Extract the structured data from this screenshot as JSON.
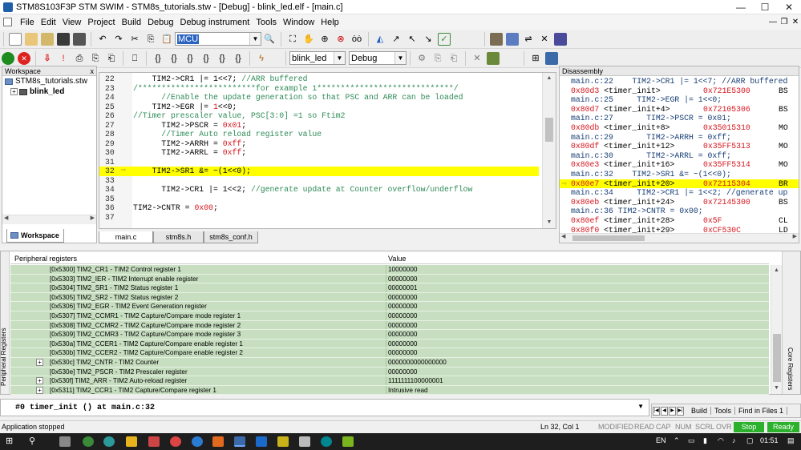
{
  "window": {
    "title": "STM8S103F3P STM SWIM - STM8s_tutorials.stw - [Debug] - blink_led.elf - [main.c]",
    "controls": {
      "minimize": "—",
      "maximize": "☐",
      "close": "✕"
    }
  },
  "menu": {
    "items": [
      "File",
      "Edit",
      "View",
      "Project",
      "Build",
      "Debug",
      "Debug instrument",
      "Tools",
      "Window",
      "Help"
    ]
  },
  "toolbar1": {
    "search_value": "MCU"
  },
  "toolbar2": {
    "project_combo": "blink_led",
    "config_combo": "Debug"
  },
  "workspace": {
    "header": "Workspace",
    "close": "x",
    "root": "STM8s_tutorials.stw",
    "project": "blink_led",
    "tab": "Workspace"
  },
  "editor": {
    "tabs": [
      "main.c",
      "stm8s.h",
      "stm8s_conf.h"
    ],
    "lines": [
      {
        "n": "22",
        "parts": [
          {
            "t": "    TIM2->CR1 |= 1<<7; "
          },
          {
            "t": "//ARR buffered",
            "c": "cm"
          }
        ]
      },
      {
        "n": "23",
        "parts": [
          {
            "t": "/*************************for example 1*****************************/",
            "c": "cm"
          }
        ]
      },
      {
        "n": "24",
        "parts": [
          {
            "t": "      //Enable the update generation so that PSC and ARR can be loaded",
            "c": "cm"
          }
        ]
      },
      {
        "n": "25",
        "parts": [
          {
            "t": "    TIM2->EGR |= "
          },
          {
            "t": "1",
            "c": "num"
          },
          {
            "t": "<<0;"
          }
        ]
      },
      {
        "n": "26",
        "parts": [
          {
            "t": "//Timer prescaler value, PSC[3:0] =1 so Ftim2",
            "c": "cm"
          }
        ]
      },
      {
        "n": "27",
        "parts": [
          {
            "t": "      TIM2->PSCR = "
          },
          {
            "t": "0x01",
            "c": "num"
          },
          {
            "t": ";"
          }
        ]
      },
      {
        "n": "28",
        "parts": [
          {
            "t": "      //Timer Auto reload register value",
            "c": "cm"
          }
        ]
      },
      {
        "n": "29",
        "parts": [
          {
            "t": "      TIM2->ARRH = "
          },
          {
            "t": "0xff",
            "c": "num"
          },
          {
            "t": ";"
          }
        ]
      },
      {
        "n": "30",
        "parts": [
          {
            "t": "      TIM2->ARRL = "
          },
          {
            "t": "0xff",
            "c": "num"
          },
          {
            "t": ";"
          }
        ]
      },
      {
        "n": "31",
        "parts": []
      },
      {
        "n": "32",
        "parts": [
          {
            "t": "    TIM2->SR1 &= ~(1<<0);"
          }
        ],
        "current": true
      },
      {
        "n": "33",
        "parts": []
      },
      {
        "n": "34",
        "parts": [
          {
            "t": "      TIM2->CR1 |= 1<<2; "
          },
          {
            "t": "//generate update at Counter overflow/underflow",
            "c": "cm"
          }
        ]
      },
      {
        "n": "35",
        "parts": []
      },
      {
        "n": "36",
        "parts": [
          {
            "t": "TIM2->CNTR = "
          },
          {
            "t": "0x00",
            "c": "num"
          },
          {
            "t": ";"
          }
        ]
      },
      {
        "n": "37",
        "parts": []
      }
    ]
  },
  "disassembly": {
    "header": "Disassembly",
    "lines": [
      {
        "kind": "src",
        "text": "main.c:22    TIM2->CR1 |= 1<<7; //ARR buffered"
      },
      {
        "kind": "asm",
        "addr": "0x80d3",
        "sym": " <timer_init>",
        "code": "0x721E5300",
        "mn": "BS"
      },
      {
        "kind": "src",
        "text": "main.c:25     TIM2->EGR |= 1<<0;"
      },
      {
        "kind": "asm",
        "addr": "0x80d7",
        "sym": " <timer_init+4>",
        "code": "0x72105306",
        "mn": "BS"
      },
      {
        "kind": "src",
        "text": "main.c:27       TIM2->PSCR = 0x01;"
      },
      {
        "kind": "asm",
        "addr": "0x80db",
        "sym": " <timer_init+8>",
        "code": "0x35015310",
        "mn": "MO"
      },
      {
        "kind": "src",
        "text": "main.c:29       TIM2->ARRH = 0xff;"
      },
      {
        "kind": "asm",
        "addr": "0x80df",
        "sym": " <timer_init+12>",
        "code": "0x35FF5313",
        "mn": "MO"
      },
      {
        "kind": "src",
        "text": "main.c:30       TIM2->ARRL = 0xff;"
      },
      {
        "kind": "asm",
        "addr": "0x80e3",
        "sym": " <timer_init+16>",
        "code": "0x35FF5314",
        "mn": "MO"
      },
      {
        "kind": "src",
        "text": "main.c:32    TIM2->SR1 &= ~(1<<0);"
      },
      {
        "kind": "asm",
        "addr": "0x80e7",
        "sym": " <timer_init+20>",
        "code": "0x72115304",
        "mn": "BR",
        "current": true
      },
      {
        "kind": "src",
        "text": "main.c:34     TIM2->CR1 |= 1<<2; //generate up"
      },
      {
        "kind": "asm",
        "addr": "0x80eb",
        "sym": " <timer_init+24>",
        "code": "0x72145300",
        "mn": "BS"
      },
      {
        "kind": "src",
        "text": "main.c:36 TIM2->CNTR = 0x00;"
      },
      {
        "kind": "asm",
        "addr": "0x80ef",
        "sym": " <timer_init+28>",
        "code": "0x5F",
        "mn": "CL"
      },
      {
        "kind": "asm",
        "addr": "0x80f0",
        "sym": " <timer_init+29>",
        "code": "0xCF530C",
        "mn": "LD"
      }
    ]
  },
  "peripheral": {
    "col_name": "Peripheral registers",
    "col_value": "Value",
    "side_label": "Peripheral Registers",
    "core_label": "Core Registers",
    "rows": [
      {
        "name": "[0x5300] TIM2_CR1 - TIM2 Control register 1",
        "value": "10000000"
      },
      {
        "name": "[0x5303] TIM2_IER - TIM2 Interrupt enable register",
        "value": "00000000"
      },
      {
        "name": "[0x5304] TIM2_SR1 - TIM2 Status register 1",
        "value": "00000001"
      },
      {
        "name": "[0x5305] TIM2_SR2 - TIM2 Status register 2",
        "value": "00000000"
      },
      {
        "name": "[0x5306] TIM2_EGR - TIM2 Event Generation register",
        "value": "00000000"
      },
      {
        "name": "[0x5307] TIM2_CCMR1 - TIM2 Capture/Compare mode register 1",
        "value": "00000000"
      },
      {
        "name": "[0x5308] TIM2_CCMR2 - TIM2 Capture/Compare mode register 2",
        "value": "00000000"
      },
      {
        "name": "[0x5309] TIM2_CCMR3 - TIM2 Capture/Compare mode register 3",
        "value": "00000000"
      },
      {
        "name": "[0x530a] TIM2_CCER1 - TIM2 Capture/Compare enable register 1",
        "value": "00000000"
      },
      {
        "name": "[0x530b] TIM2_CCER2 - TIM2 Capture/Compare enable register 2",
        "value": "00000000"
      },
      {
        "name": "[0x530c] TIM2_CNTR - TIM2 Counter",
        "value": "0000000000000000",
        "expand": true
      },
      {
        "name": "[0x530e] TIM2_PSCR - TIM2 Prescaler register",
        "value": "00000000"
      },
      {
        "name": "[0x530f] TIM2_ARR - TIM2 Auto-reload register",
        "value": "1111111100000001",
        "expand": true
      },
      {
        "name": "[0x5311] TIM2_CCR1 - TIM2 Capture/Compare register 1",
        "value": "Intrusive read",
        "expand": true
      }
    ]
  },
  "callstack": {
    "text": "#0  timer_init () at main.c:32"
  },
  "output_tabs": [
    "Build",
    "Tools",
    "Find in Files 1"
  ],
  "status": {
    "left": "Application stopped",
    "position": "Ln 32, Col 1",
    "indicators": [
      "MODIFIED",
      "READ",
      "CAP",
      "NUM",
      "SCRL",
      "OVR"
    ],
    "stop": "Stop",
    "ready": "Ready"
  },
  "taskbar": {
    "lang": "EN",
    "time": "01:51"
  },
  "colors": {
    "highlight": "#ffff00",
    "register_row": "#c7dfc0",
    "comment": "#2e8b57",
    "number": "#d7171f"
  }
}
